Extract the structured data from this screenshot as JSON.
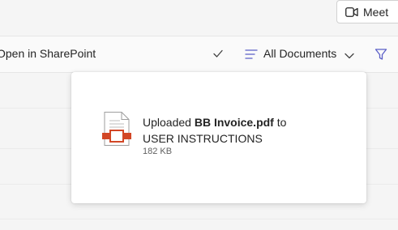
{
  "header": {
    "meet_label": "Meet",
    "meet_icon": "video-camera-icon"
  },
  "toolbar": {
    "open_label": "Open in SharePoint",
    "check_icon": "checkmark-icon",
    "view_icon": "lines-icon",
    "view_label": "All Documents",
    "chevron_icon": "chevron-down-icon",
    "filter_icon": "filter-icon"
  },
  "toast": {
    "prefix": "Uploaded ",
    "file_name": "BB Invoice.pdf",
    "middle": " to",
    "destination": "USER INSTRUCTIONS",
    "size": "182 KB",
    "file_icon": "pdf-file-icon",
    "accent_color": "#d24726"
  }
}
